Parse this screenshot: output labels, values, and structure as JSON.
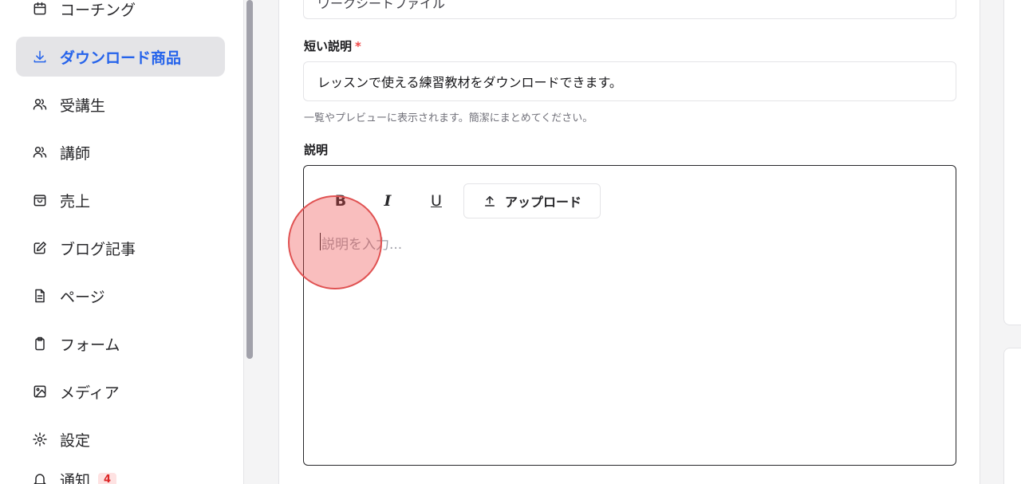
{
  "sidebar": {
    "items": [
      {
        "label": "コーチング",
        "icon": "calendar-icon",
        "active": false
      },
      {
        "label": "ダウンロード商品",
        "icon": "download-icon",
        "active": true
      },
      {
        "label": "受講生",
        "icon": "users-icon",
        "active": false
      },
      {
        "label": "講師",
        "icon": "users-icon",
        "active": false
      },
      {
        "label": "売上",
        "icon": "shopping-bag-icon",
        "active": false
      },
      {
        "label": "ブログ記事",
        "icon": "edit-icon",
        "active": false
      },
      {
        "label": "ページ",
        "icon": "file-text-icon",
        "active": false
      },
      {
        "label": "フォーム",
        "icon": "clipboard-icon",
        "active": false
      },
      {
        "label": "メディア",
        "icon": "image-icon",
        "active": false
      },
      {
        "label": "設定",
        "icon": "gear-icon",
        "active": false
      },
      {
        "label": "通知",
        "icon": "bell-icon",
        "active": false,
        "badge": "4"
      }
    ]
  },
  "form": {
    "prev_field_value": "ワークシートファイル",
    "short_desc": {
      "label": "短い説明",
      "required_mark": "*",
      "value": "レッスンで使える練習教材をダウンロードできます。",
      "help": "一覧やプレビューに表示されます。簡潔にまとめてください。"
    },
    "description": {
      "label": "説明",
      "toolbar": {
        "bold": "B",
        "italic": "I",
        "underline": "U",
        "upload": "アップロード"
      },
      "placeholder": "説明を入力..."
    }
  },
  "colors": {
    "accent": "#2563eb",
    "active_bg": "#e4e4e7",
    "required": "#ef4444",
    "badge_bg": "#fee2e2",
    "badge_text": "#dc2626"
  }
}
